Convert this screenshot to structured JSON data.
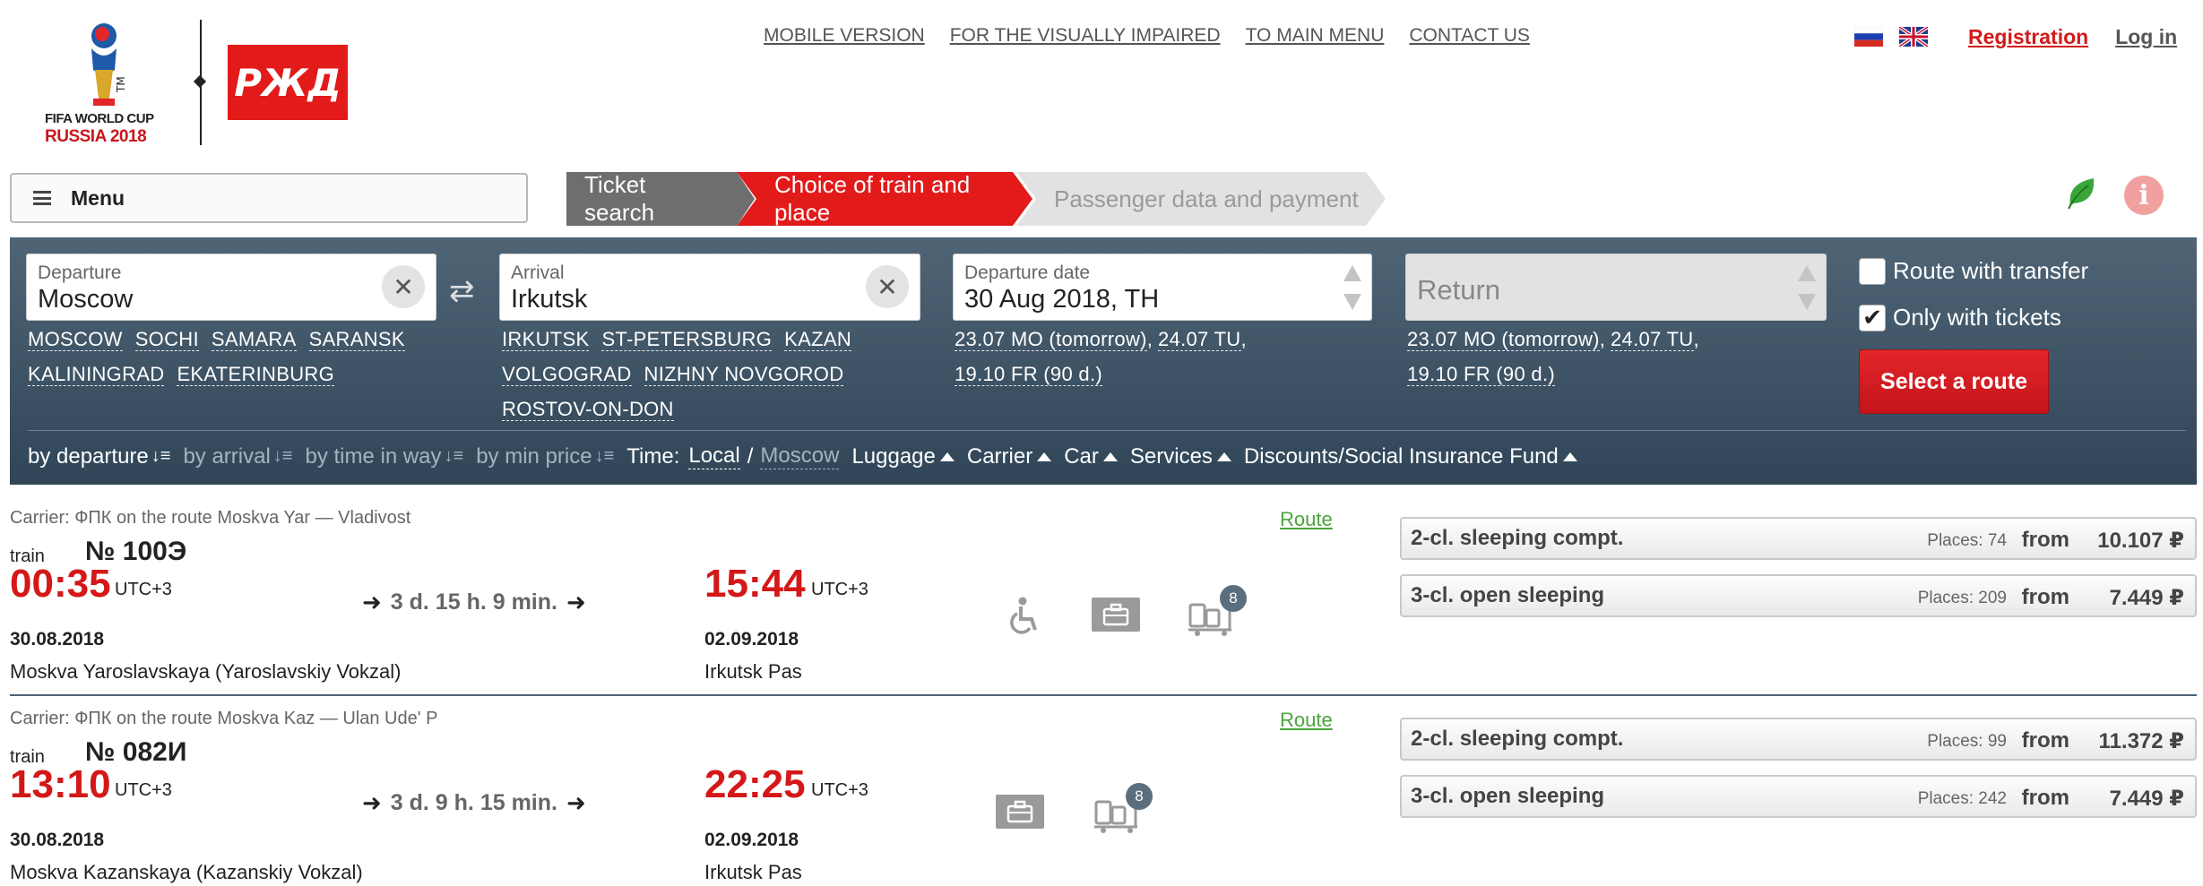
{
  "header": {
    "logo_wc_line1": "FIFA WORLD CUP",
    "logo_wc_line2": "RUSSIA 2018",
    "logo_rzd": "РЖД",
    "nav": [
      "MOBILE VERSION",
      "FOR THE VISUALLY IMPAIRED",
      "TO MAIN MENU",
      "CONTACT US"
    ],
    "registration": "Registration",
    "login": "Log in"
  },
  "menu": {
    "label": "Menu"
  },
  "steps": [
    "Ticket search",
    "Choice of train and place",
    "Passenger data and payment"
  ],
  "search": {
    "departure_label": "Departure",
    "departure_value": "Moscow",
    "departure_quick": [
      "MOSCOW",
      "SOCHI",
      "SAMARA",
      "SARANSK",
      "KALININGRAD",
      "EKATERINBURG"
    ],
    "arrival_label": "Arrival",
    "arrival_value": "Irkutsk",
    "arrival_quick": [
      "IRKUTSK",
      "ST-PETERSBURG",
      "KAZAN",
      "VOLGOGRAD",
      "NIZHNY NOVGOROD",
      "ROSTOV-ON-DON"
    ],
    "date_label": "Departure date",
    "date_value": "30 Aug 2018, TH",
    "date_quick": [
      "23.07 MO (tomorrow)",
      "24.07 TU",
      "19.10 FR (90 d.)"
    ],
    "return_placeholder": "Return",
    "return_quick": [
      "23.07 MO (tomorrow)",
      "24.07 TU",
      "19.10 FR (90 d.)"
    ],
    "route_with_transfer": "Route with transfer",
    "only_with_tickets": "Only with tickets",
    "select_route": "Select a route"
  },
  "sort": {
    "by_departure": "by departure",
    "by_arrival": "by arrival",
    "by_time": "by time in way",
    "by_price": "by min price",
    "time_label": "Time:",
    "local": "Local",
    "moscow": "Moscow",
    "filters": [
      "Luggage",
      "Carrier",
      "Car",
      "Services",
      "Discounts/Social Insurance Fund"
    ]
  },
  "trains": [
    {
      "carrier": "Carrier: ФПК   on the route Moskva Yar — Vladivost",
      "route_link": "Route",
      "train_label": "train",
      "number": "№ 100Э",
      "dep_time": "00:35",
      "dep_tz": "UTC+3",
      "duration": "3 d. 15 h. 9 min.",
      "arr_time": "15:44",
      "arr_tz": "UTC+3",
      "dep_date": "30.08.2018",
      "arr_date": "02.09.2018",
      "dep_station": "Moskva Yaroslavskaya (Yaroslavskiy Vokzal)",
      "arr_station": "Irkutsk Pas",
      "luggage_badge": "8",
      "cars": [
        {
          "name": "2-cl. sleeping compt.",
          "places_label": "Places:",
          "places": "74",
          "from": "from",
          "price": "10.107 ₽"
        },
        {
          "name": "3-cl. open sleeping",
          "places_label": "Places:",
          "places": "209",
          "from": "from",
          "price": "7.449 ₽"
        }
      ]
    },
    {
      "carrier": "Carrier: ФПК   on the route Moskva Kaz — Ulan Ude' P",
      "route_link": "Route",
      "train_label": "train",
      "number": "№ 082И",
      "dep_time": "13:10",
      "dep_tz": "UTC+3",
      "duration": "3 d. 9 h. 15 min.",
      "arr_time": "22:25",
      "arr_tz": "UTC+3",
      "dep_date": "30.08.2018",
      "arr_date": "02.09.2018",
      "dep_station": "Moskva Kazanskaya (Kazanskiy Vokzal)",
      "arr_station": "Irkutsk Pas",
      "luggage_badge": "8",
      "cars": [
        {
          "name": "2-cl. sleeping compt.",
          "places_label": "Places:",
          "places": "99",
          "from": "from",
          "price": "11.372 ₽"
        },
        {
          "name": "3-cl. open sleeping",
          "places_label": "Places:",
          "places": "242",
          "from": "from",
          "price": "7.449 ₽"
        }
      ]
    }
  ],
  "colors": {
    "brand_red": "#e21a1a",
    "panel": "#3f5566",
    "route_green": "#4aa53b"
  }
}
